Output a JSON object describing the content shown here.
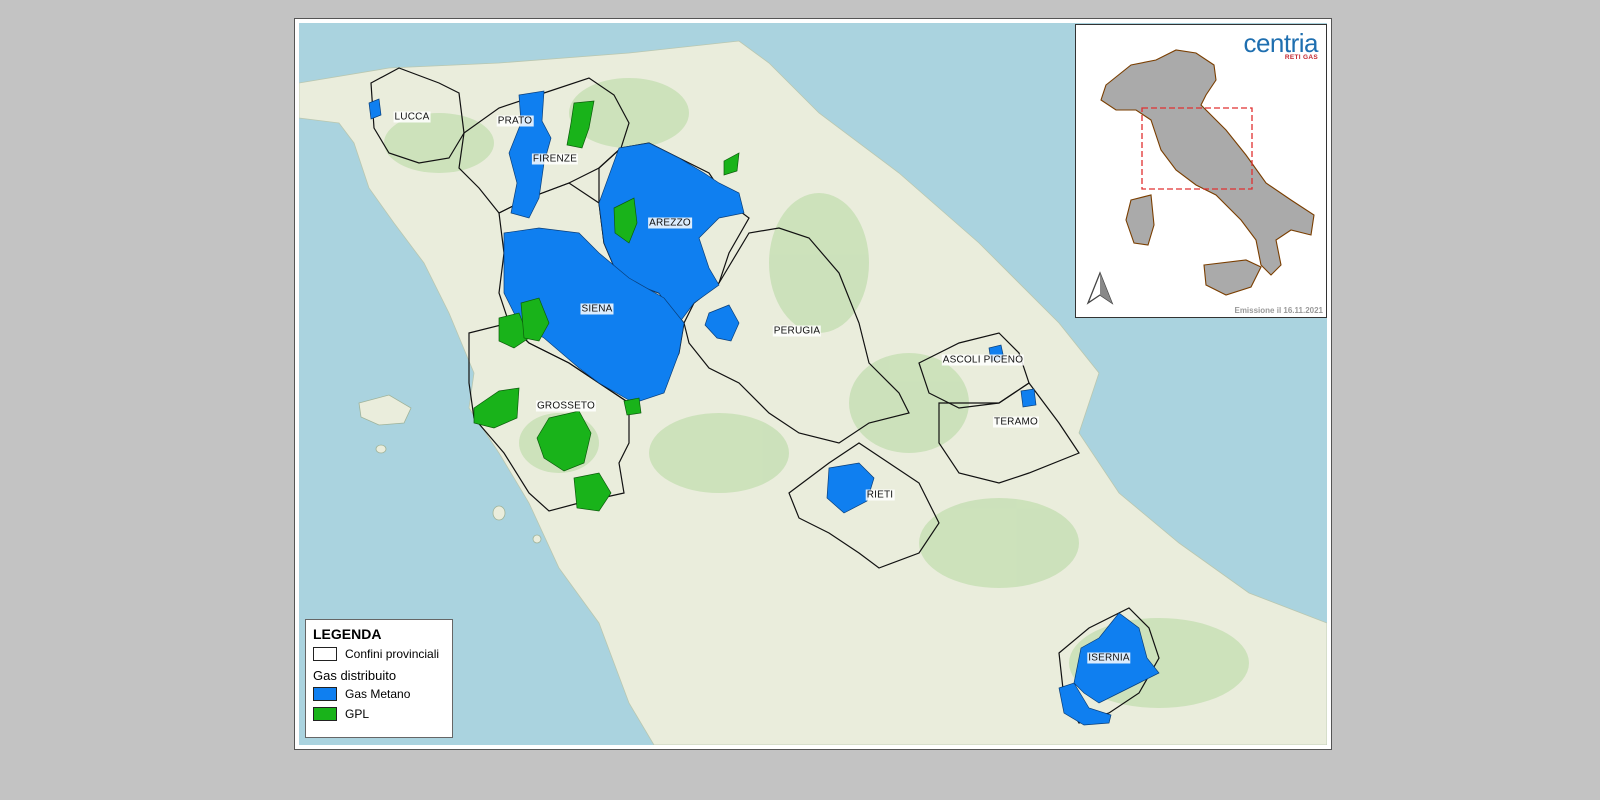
{
  "colors": {
    "sea": "#aad3df",
    "land": "#eaeddc",
    "forest": "#c3ddb0",
    "gas_metano": "#0f7ff0",
    "gpl": "#19b31a",
    "province_border": "#111111",
    "inset_region": "#aaaaaa",
    "inset_border": "#7a3e00",
    "inset_frame": "#e03030"
  },
  "provinces": {
    "lucca": "LUCCA",
    "prato": "PRATO",
    "firenze": "FIRENZE",
    "arezzo": "AREZZO",
    "siena": "SIENA",
    "perugia": "PERUGIA",
    "ascoli_piceno": "ASCOLI PICENO",
    "grosseto": "GROSSETO",
    "teramo": "TERAMO",
    "rieti": "RIETI",
    "isernia": "ISERNIA"
  },
  "legend": {
    "title": "LEGENDA",
    "boundaries": "Confini provinciali",
    "subtitle": "Gas distribuito",
    "metano": "Gas Metano",
    "gpl": "GPL"
  },
  "inset": {
    "logo_name": "centria",
    "logo_sub": "RETI GAS",
    "emission": "Emissione il 16.11.2021",
    "north_arrow_icon": "north-arrow-icon"
  }
}
